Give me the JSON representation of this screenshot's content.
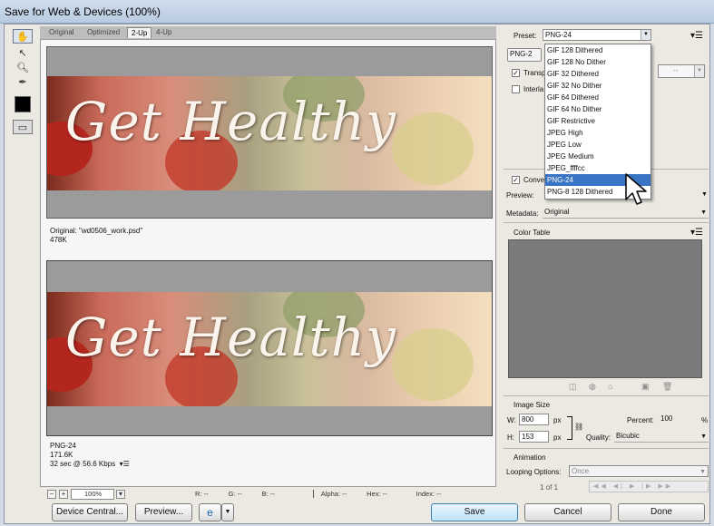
{
  "window": {
    "title": "Save for Web & Devices (100%)"
  },
  "view_tabs": [
    "Original",
    "Optimized",
    "2-Up",
    "4-Up"
  ],
  "active_tab": "2-Up",
  "image": {
    "text": "Get Healthy"
  },
  "original_info": {
    "line1": "Original: \"wd0506_work.psd\"",
    "line2": "478K"
  },
  "optimized_info": {
    "line1": "PNG-24",
    "line2": "171.6K",
    "line3": "32 sec @ 56.6 Kbps",
    "menu_glyph": "▾☰"
  },
  "bottom_bar": {
    "zoom": "100%",
    "r": "R: --",
    "g": "G: --",
    "b": "B: --",
    "alpha": "Alpha: --",
    "hex": "Hex: --",
    "index": "Index: --"
  },
  "preset": {
    "label": "Preset:",
    "value": "PNG-24",
    "format_value": "PNG-2"
  },
  "preset_menu": {
    "items": [
      "GIF 128 Dithered",
      "GIF 128 No Dither",
      "GIF 32 Dithered",
      "GIF 32 No Dither",
      "GIF 64 Dithered",
      "GIF 64 No Dither",
      "GIF Restrictive",
      "JPEG High",
      "JPEG Low",
      "JPEG Medium",
      "JPEG_ffffcc",
      "PNG-24",
      "PNG-8 128 Dithered"
    ],
    "highlighted": "PNG-24"
  },
  "options": {
    "transparency": "Transp",
    "interlaced": "Interla",
    "matte_value": "--",
    "convert": "Conve",
    "preview_label": "Preview:",
    "metadata_label": "Metadata:",
    "metadata_value": "Original"
  },
  "color_table": {
    "title": "Color Table"
  },
  "image_size": {
    "title": "Image Size",
    "w_label": "W:",
    "w_value": "800",
    "h_label": "H:",
    "h_value": "153",
    "px": "px",
    "percent_label": "Percent:",
    "percent_value": "100",
    "percent_unit": "%",
    "quality_label": "Quality:",
    "quality_value": "Bicubic"
  },
  "animation": {
    "title": "Animation",
    "looping_label": "Looping Options:",
    "looping_value": "Once",
    "frame": "1 of 1"
  },
  "buttons": {
    "device_central": "Device Central...",
    "preview": "Preview...",
    "save": "Save",
    "cancel": "Cancel",
    "done": "Done"
  },
  "colors": {
    "menu_highlight": "#3a74c4",
    "color_table_bg": "#7b7b7b"
  }
}
